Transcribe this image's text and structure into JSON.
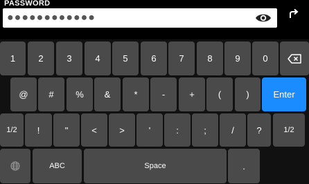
{
  "password": {
    "label": "PASSWORD",
    "masked_value": "●●●●●●●●●●●●"
  },
  "icons": {
    "visibility": "eye-icon",
    "undo": "undo-arrow-icon",
    "backspace": "backspace-icon",
    "language": "globe-icon"
  },
  "keyboard": {
    "row1": [
      "1",
      "2",
      "3",
      "4",
      "5",
      "6",
      "7",
      "8",
      "9",
      "0"
    ],
    "row2": [
      "@",
      "#",
      "%",
      "&",
      "*",
      "-",
      "+",
      "(",
      ")"
    ],
    "enter_label": "Enter",
    "row3": [
      "1/2",
      "!",
      "\"",
      "<",
      ">",
      "'",
      ":",
      ";",
      "/",
      "?",
      "1/2"
    ],
    "abc_label": "ABC",
    "space_label": "Space",
    "period_label": "."
  },
  "colors": {
    "key": "#4a4a4a",
    "enter": "#1a8cff",
    "background": "#000000"
  }
}
